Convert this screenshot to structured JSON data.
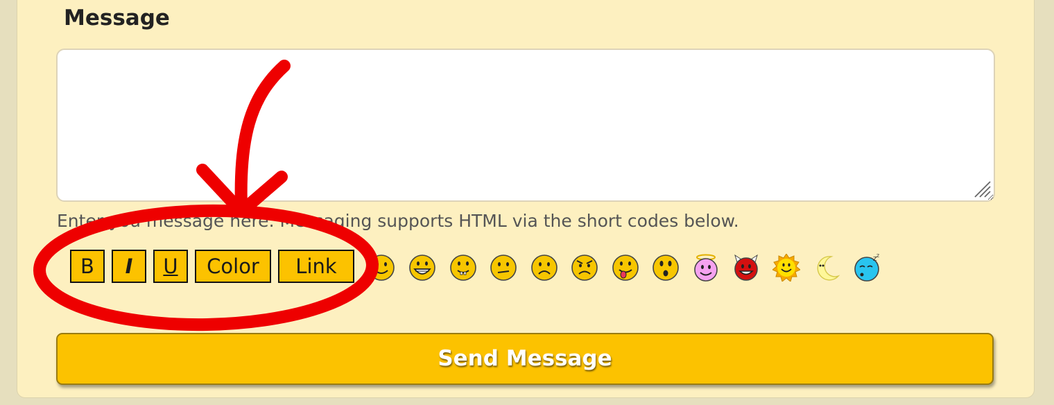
{
  "form": {
    "label": "Message",
    "textarea_value": "",
    "help_text": "Enter you message here. Messaging supports HTML via the short codes below.",
    "send_label": "Send Message"
  },
  "format_buttons": [
    {
      "label": "B"
    },
    {
      "label": "I"
    },
    {
      "label": "U"
    },
    {
      "label": "Color"
    },
    {
      "label": "Link"
    }
  ],
  "emoticons": [
    "smile",
    "grin",
    "teeth",
    "neutral",
    "sad",
    "angry",
    "tongue",
    "surprised",
    "angel",
    "devil",
    "sun",
    "moon",
    "sleepy"
  ],
  "colors": {
    "panel_bg": "#fdf0c0",
    "button_yellow": "#fcc200",
    "annotation_red": "#ee0000"
  }
}
